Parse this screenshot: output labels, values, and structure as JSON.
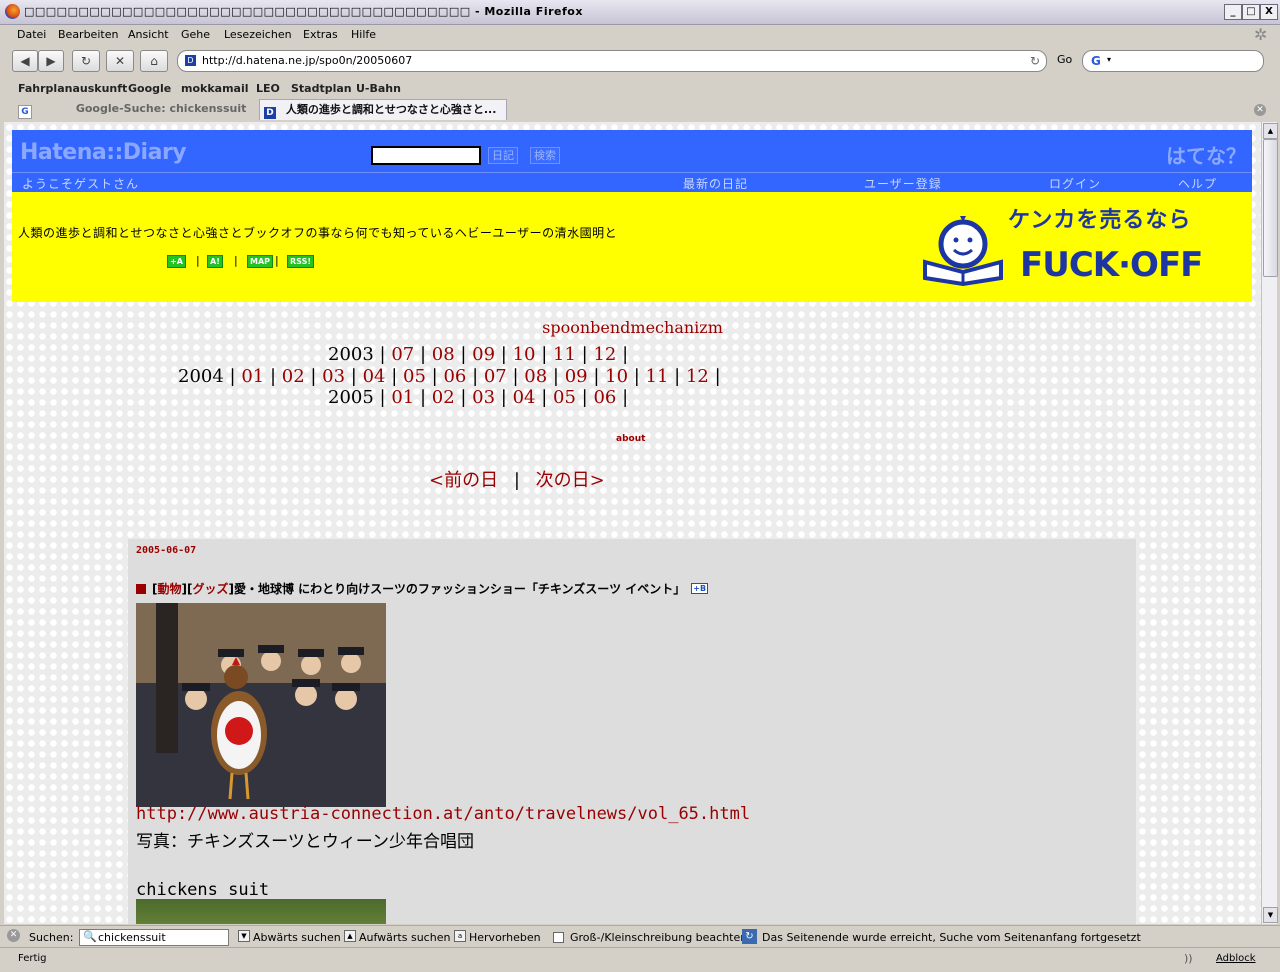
{
  "window": {
    "title": "□□□□□□□□□□□□□□□□□□□□□□□□□□□□□□□□□□□□□□□□□ - Mozilla Firefox",
    "min": "_",
    "max": "□",
    "close": "X"
  },
  "menu": [
    "Datei",
    "Bearbeiten",
    "Ansicht",
    "Gehe",
    "Lesezeichen",
    "Extras",
    "Hilfe"
  ],
  "nav": {
    "back": "◀",
    "forward": "▶",
    "reload": "↻",
    "stop": "✕",
    "home": "⌂",
    "url": "http://d.hatena.ne.jp/spo0n/20050607",
    "go": "Go",
    "search_engine": "G"
  },
  "bookmarks": [
    "Fahrplanauskunft",
    "Google",
    "mokkamail",
    "LEO",
    "Stadtplan",
    "U-Bahn"
  ],
  "tabs": [
    {
      "label": "Google-Suche: chickenssuit",
      "icon": "G"
    },
    {
      "label": "人類の進歩と調和とせつなさと心強さと...",
      "icon": "D"
    }
  ],
  "hatena": {
    "logo": "Hatena::Diary",
    "search_btn1": "日記",
    "search_btn2": "検索",
    "brand": "はてな？",
    "welcome": "ようこそゲストさん",
    "nav": [
      "最新の日記",
      "ユーザー登録",
      "ログイン",
      "ヘルプ"
    ]
  },
  "banner": {
    "description": "人類の進歩と調和とせつなさと心強さとブックオフの事なら何でも知っているヘビーユーザーの清水國明と",
    "badges": [
      "+A",
      "A!",
      "MAP",
      "RSS!"
    ],
    "ad_jp": "ケンカを売るなら",
    "ad_en": "FUCK·OFF"
  },
  "diary": {
    "title": "spoonbendmechanizm",
    "calendar": [
      {
        "year": "2003",
        "months": [
          "07",
          "08",
          "09",
          "10",
          "11",
          "12"
        ]
      },
      {
        "year": "2004",
        "months": [
          "01",
          "02",
          "03",
          "04",
          "05",
          "06",
          "07",
          "08",
          "09",
          "10",
          "11",
          "12"
        ]
      },
      {
        "year": "2005",
        "months": [
          "01",
          "02",
          "03",
          "04",
          "05",
          "06"
        ]
      }
    ],
    "about": "about",
    "prev_day": "<前の日",
    "next_day": "次の日>",
    "sep": "|"
  },
  "entry": {
    "date": "2005-06-07",
    "cat1": "動物",
    "cat2": "グッズ",
    "title": "愛・地球博 にわとり向けスーツのファッションショー「チキンズスーツ イベント」",
    "bookmark": "+B",
    "link": "http://www.austria-connection.at/anto/travelnews/vol_65.html",
    "caption": "写真：チキンズスーツとウィーン少年合唱団",
    "subheading": "chickens suit"
  },
  "findbar": {
    "label": "Suchen:",
    "value": "chickenssuit",
    "next": "Abwärts suchen",
    "prev": "Aufwärts suchen",
    "highlight": "Hervorheben",
    "matchcase": "Groß-/Kleinschreibung beachten",
    "status": "Das Seitenende wurde erreicht, Suche vom Seitenanfang fortgesetzt"
  },
  "statusbar": {
    "text": "Fertig",
    "adblock": "Adblock"
  }
}
